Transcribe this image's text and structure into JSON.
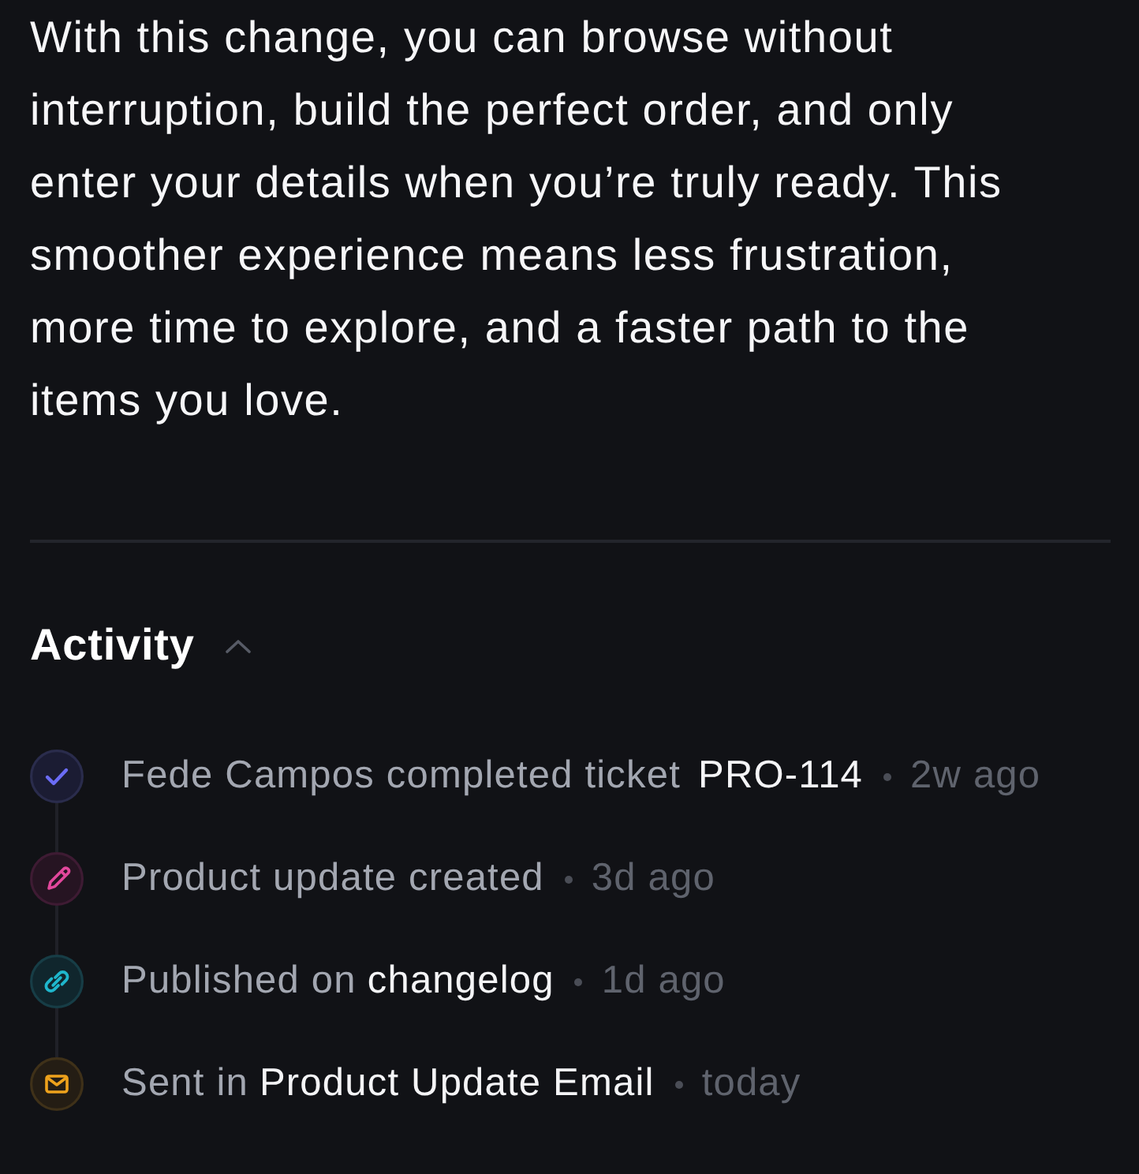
{
  "body": {
    "text": "With this change, you can browse without interruption, build the perfect order, and only enter your details when you’re truly ready. This smoother experience means less frustration, more time to explore, and a faster path to the items you love."
  },
  "activity": {
    "title": "Activity",
    "expanded": true,
    "items": [
      {
        "kind": "completed",
        "text": "Fede Campos completed ticket",
        "link": "PRO-114",
        "time": "2w ago"
      },
      {
        "kind": "edited",
        "text": "Product update created",
        "time": "3d ago"
      },
      {
        "kind": "published",
        "text": "Published on",
        "link": "changelog",
        "time": "1d ago"
      },
      {
        "kind": "email",
        "text": "Sent in",
        "link": "Product Update Email",
        "time": "today"
      }
    ]
  }
}
